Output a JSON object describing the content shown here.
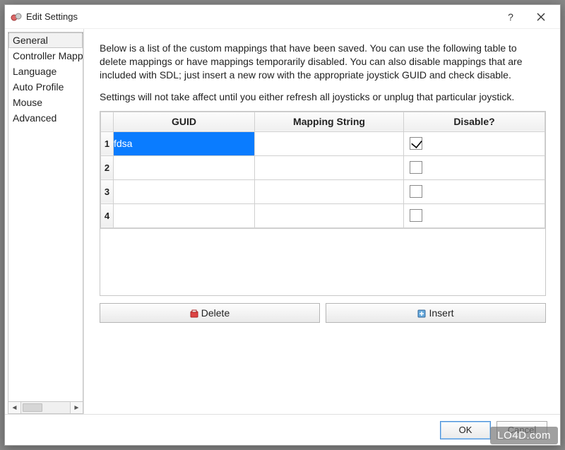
{
  "window": {
    "title": "Edit Settings",
    "help": "?",
    "close": "×"
  },
  "sidebar": {
    "items": [
      {
        "label": "General",
        "selected": true
      },
      {
        "label": "Controller Mapping",
        "selected": false
      },
      {
        "label": "Language",
        "selected": false
      },
      {
        "label": "Auto Profile",
        "selected": false
      },
      {
        "label": "Mouse",
        "selected": false
      },
      {
        "label": "Advanced",
        "selected": false
      }
    ]
  },
  "main": {
    "desc1": "Below is a list of the custom mappings that have been saved. You can use the following table to delete mappings or have mappings temporarily disabled. You can also disable mappings that are included with SDL; just insert a new row with the appropriate joystick GUID and check disable.",
    "desc2": "Settings will not take affect until you either refresh all joysticks or unplug that particular joystick.",
    "columns": {
      "guid": "GUID",
      "mapping": "Mapping String",
      "disable": "Disable?"
    },
    "rows": [
      {
        "n": "1",
        "guid": "fdsa",
        "mapping": "",
        "disable": true,
        "selected": true
      },
      {
        "n": "2",
        "guid": "",
        "mapping": "",
        "disable": false,
        "selected": false
      },
      {
        "n": "3",
        "guid": "",
        "mapping": "",
        "disable": false,
        "selected": false
      },
      {
        "n": "4",
        "guid": "",
        "mapping": "",
        "disable": false,
        "selected": false
      }
    ],
    "delete_label": "Delete",
    "insert_label": "Insert"
  },
  "footer": {
    "ok": "OK",
    "cancel": "Cancel"
  },
  "watermark": "LO4D.com"
}
